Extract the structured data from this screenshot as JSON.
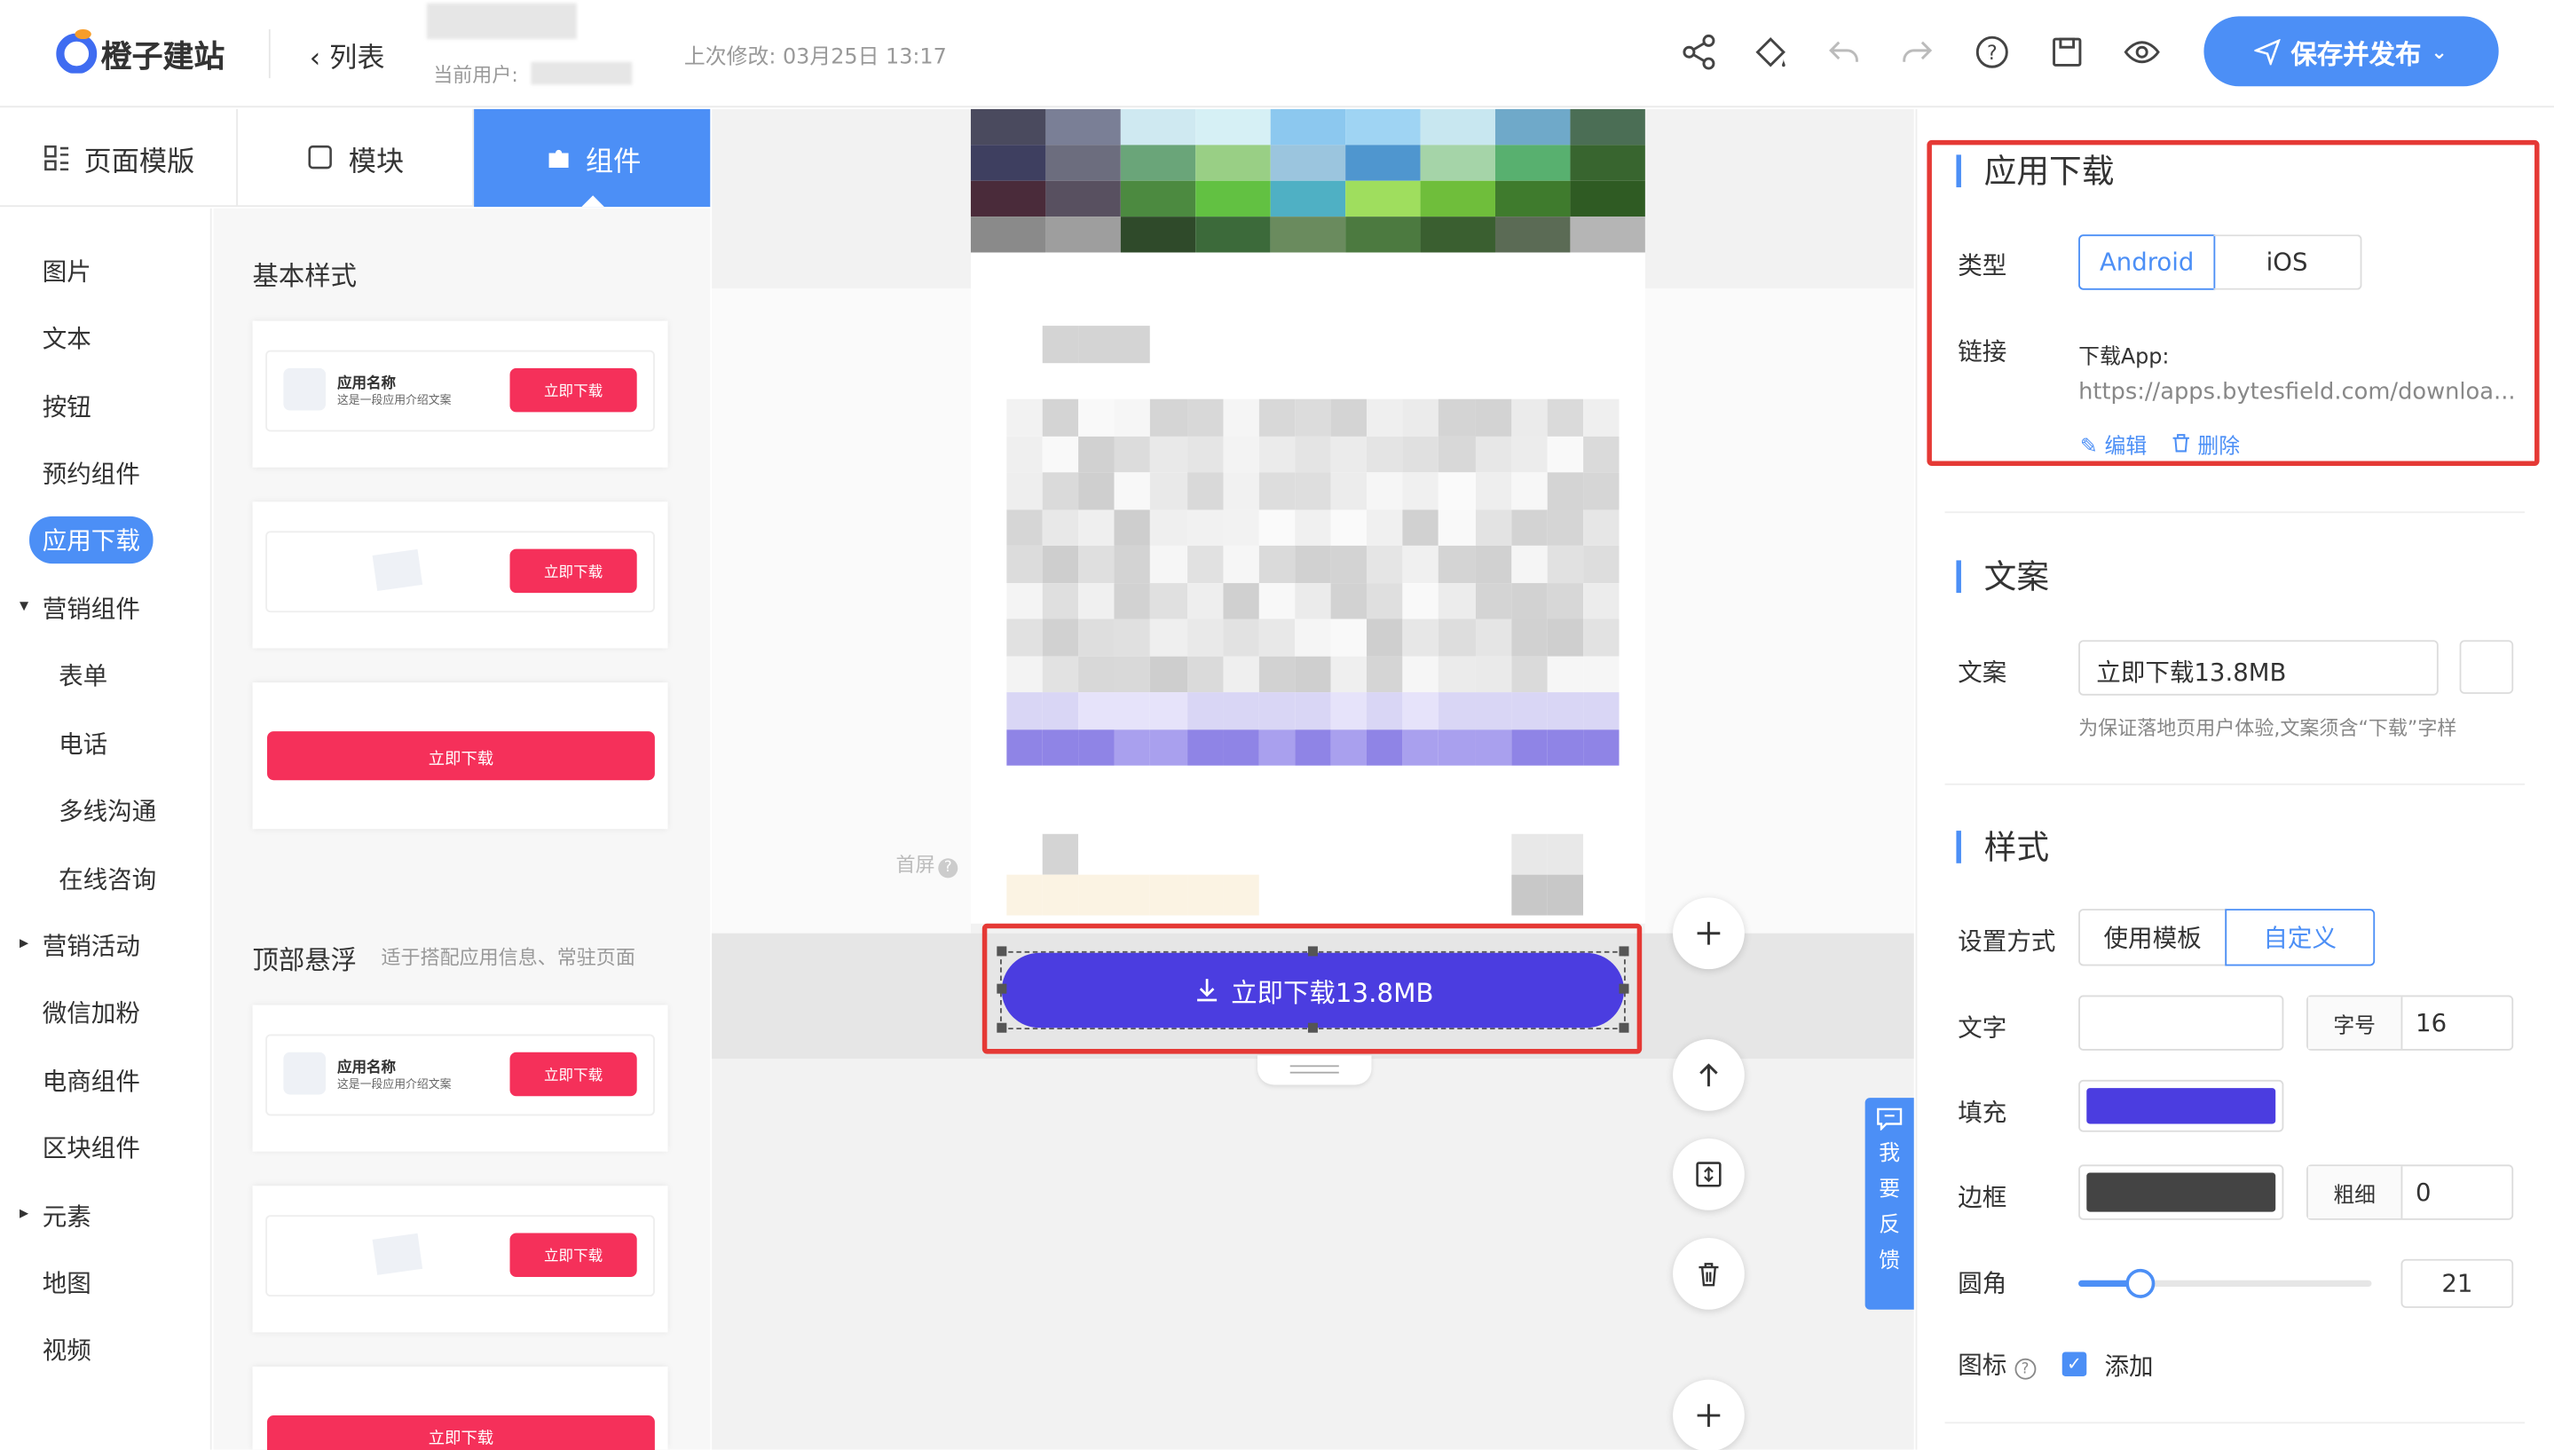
{
  "header": {
    "brand": "橙子建站",
    "back_label": "列表",
    "current_user_label": "当前用户:",
    "last_modified": "上次修改: 03月25日 13:17",
    "publish_label": "保存并发布",
    "tools": [
      "share-icon",
      "paint-bucket-icon",
      "undo-icon",
      "redo-icon",
      "help-icon",
      "save-icon",
      "preview-icon"
    ]
  },
  "left_tabs": [
    {
      "label": "页面模版",
      "icon": "template-icon"
    },
    {
      "label": "模块",
      "icon": "module-icon"
    },
    {
      "label": "组件",
      "icon": "component-icon"
    }
  ],
  "categories": [
    {
      "label": "图片"
    },
    {
      "label": "文本"
    },
    {
      "label": "按钮"
    },
    {
      "label": "预约组件"
    },
    {
      "label": "应用下载",
      "active": true
    },
    {
      "label": "营销组件",
      "expanded": true
    },
    {
      "label": "表单",
      "sub": true
    },
    {
      "label": "电话",
      "sub": true
    },
    {
      "label": "多线沟通",
      "sub": true
    },
    {
      "label": "在线咨询",
      "sub": true
    },
    {
      "label": "营销活动",
      "collapsed": true
    },
    {
      "label": "微信加粉"
    },
    {
      "label": "电商组件"
    },
    {
      "label": "区块组件"
    },
    {
      "label": "元素",
      "collapsed": true
    },
    {
      "label": "地图"
    },
    {
      "label": "视频"
    }
  ],
  "cards": {
    "basic_title": "基本样式",
    "top_float_title": "顶部悬浮",
    "top_float_desc": "适于搭配应用信息、常驻页面",
    "app_name": "应用名称",
    "app_desc": "这是一段应用介绍文案",
    "download_label": "立即下载"
  },
  "canvas": {
    "first_screen_label": "首屏",
    "download_button_label": "立即下载13.8MB"
  },
  "feedback": [
    "我",
    "要",
    "反",
    "馈"
  ],
  "right": {
    "app_section_title": "应用下载",
    "type_label": "类型",
    "type_options": [
      "Android",
      "iOS"
    ],
    "type_selected": "Android",
    "link_label": "链接",
    "link_sub": "下载App:",
    "link_url": "https://apps.bytesfield.com/downloa...",
    "edit_label": "编辑",
    "delete_label": "删除",
    "copy_section_title": "文案",
    "copy_label": "文案",
    "copy_value": "立即下载13.8MB",
    "copy_hint": "为保证落地页用户体验,文案须含“下载”字样",
    "style_section_title": "样式",
    "setting_label": "设置方式",
    "setting_options": [
      "使用模板",
      "自定义"
    ],
    "setting_selected": "自定义",
    "text_label": "文字",
    "font_size_label": "字号",
    "font_size": "16",
    "fill_label": "填充",
    "fill_color": "#4b3de0",
    "border_label": "边框",
    "border_color": "#444444",
    "border_width_label": "粗细",
    "border_width": "0",
    "radius_label": "圆角",
    "radius_value": "21",
    "icon_label": "图标",
    "icon_add_label": "添加"
  },
  "colors": {
    "accent": "#4c8ff6",
    "download_red": "#f5305a",
    "selection_red": "#e53935"
  }
}
